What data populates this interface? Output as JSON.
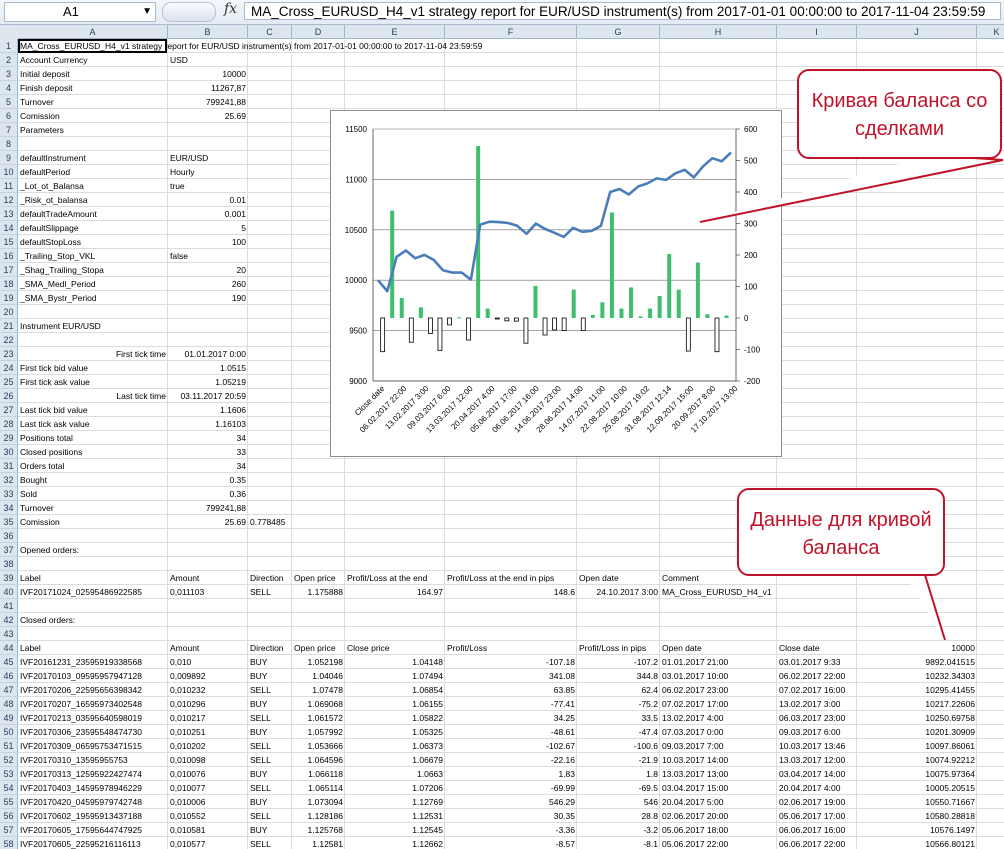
{
  "formula_bar": {
    "name_box": "A1",
    "fx": "fx",
    "content": "MA_Cross_EURUSD_H4_v1 strategy report for EUR/USD instrument(s) from 2017-01-01 00:00:00 to 2017-11-04 23:59:59"
  },
  "columns": [
    "A",
    "B",
    "C",
    "D",
    "E",
    "F",
    "G",
    "H",
    "I",
    "J",
    "K"
  ],
  "rows": [
    {
      "n": "1",
      "A": "MA_Cross_EURUSD_H4_v1 strategy report for EUR/USD instrument(s) from 2017-01-01 00:00:00 to 2017-11-04 23:59:59"
    },
    {
      "n": "2",
      "A": "Account Currency",
      "B": "USD"
    },
    {
      "n": "3",
      "A": "Initial deposit",
      "B": "10000"
    },
    {
      "n": "4",
      "A": "Finish deposit",
      "B": "11267,87"
    },
    {
      "n": "5",
      "A": "Turnover",
      "B": "799241,88"
    },
    {
      "n": "6",
      "A": "Comission",
      "B": "25.69"
    },
    {
      "n": "7",
      "A": "Parameters"
    },
    {
      "n": "8"
    },
    {
      "n": "9",
      "A": "defaultInstrument",
      "B": "EUR/USD"
    },
    {
      "n": "10",
      "A": "defaultPeriod",
      "B": "Hourly"
    },
    {
      "n": "11",
      "A": "_Lot_ot_Balansa",
      "B": "true"
    },
    {
      "n": "12",
      "A": "_Risk_ot_balansa",
      "B": "0.01"
    },
    {
      "n": "13",
      "A": "defaultTradeAmount",
      "B": "0.001"
    },
    {
      "n": "14",
      "A": "defaultSlippage",
      "B": "5"
    },
    {
      "n": "15",
      "A": "defaultStopLoss",
      "B": "100"
    },
    {
      "n": "16",
      "A": "_Trailing_Stop_VKL",
      "B": "false"
    },
    {
      "n": "17",
      "A": "_Shag_Trailing_Stopa",
      "B": "20"
    },
    {
      "n": "18",
      "A": "_SMA_Medl_Period",
      "B": "260"
    },
    {
      "n": "19",
      "A": "_SMA_Bystr_Period",
      "B": "190"
    },
    {
      "n": "20"
    },
    {
      "n": "21",
      "A": "Instrument EUR/USD"
    },
    {
      "n": "22"
    },
    {
      "n": "23",
      "A": "First tick time",
      "B": "01.01.2017 0:00"
    },
    {
      "n": "24",
      "A": "First tick bid value",
      "B": "1.0515"
    },
    {
      "n": "25",
      "A": "First tick ask value",
      "B": "1.05219"
    },
    {
      "n": "26",
      "A": "Last tick time",
      "B": "03.11.2017 20:59"
    },
    {
      "n": "27",
      "A": "Last tick bid value",
      "B": "1.1606"
    },
    {
      "n": "28",
      "A": "Last tick ask value",
      "B": "1.16103"
    },
    {
      "n": "29",
      "A": "Positions total",
      "B": "34"
    },
    {
      "n": "30",
      "A": "Closed positions",
      "B": "33"
    },
    {
      "n": "31",
      "A": "Orders total",
      "B": "34"
    },
    {
      "n": "32",
      "A": "Bought",
      "B": "0.35"
    },
    {
      "n": "33",
      "A": "Sold",
      "B": "0.36"
    },
    {
      "n": "34",
      "A": "Turnover",
      "B": "799241,88"
    },
    {
      "n": "35",
      "A": "Comission",
      "B": "25.69",
      "C": "0.778485"
    },
    {
      "n": "36"
    },
    {
      "n": "37",
      "A": "Opened orders:"
    },
    {
      "n": "38"
    },
    {
      "n": "39",
      "A": "Label",
      "B": "Amount",
      "C": "Direction",
      "D": "Open price",
      "E": "Profit/Loss at the end",
      "F": "Profit/Loss at the end in pips",
      "G": "Open date",
      "H": "Comment"
    },
    {
      "n": "40",
      "A": "IVF20171024_02595486922585",
      "B": "0,011103",
      "C": "SELL",
      "D": "1.175888",
      "E": "164.97",
      "F": "148.6",
      "G": "24.10.2017 3:00",
      "H": "MA_Cross_EURUSD_H4_v1"
    },
    {
      "n": "41"
    },
    {
      "n": "42",
      "A": "Closed orders:"
    },
    {
      "n": "43"
    },
    {
      "n": "44",
      "A": "Label",
      "B": "Amount",
      "C": "Direction",
      "D": "Open price",
      "E": "Close price",
      "F": "Profit/Loss",
      "G": "Profit/Loss in pips",
      "H": "Open date",
      "I": "Close date",
      "J": "10000"
    },
    {
      "n": "45",
      "A": "IVF20161231_23595919338568",
      "B": "0,010",
      "C": "BUY",
      "D": "1.052198",
      "E": "1.04148",
      "F": "-107.18",
      "G": "-107.2",
      "H": "01.01.2017 21:00",
      "I": "03.01.2017 9:33",
      "J": "9892.041515"
    },
    {
      "n": "46",
      "A": "IVF20170103_09595957947128",
      "B": "0,009892",
      "C": "BUY",
      "D": "1.04046",
      "E": "1.07494",
      "F": "341.08",
      "G": "344.8",
      "H": "03.01.2017 10:00",
      "I": "06.02.2017 22:00",
      "J": "10232.34303"
    },
    {
      "n": "47",
      "A": "IVF20170206_22595656398342",
      "B": "0,010232",
      "C": "SELL",
      "D": "1.07478",
      "E": "1.06854",
      "F": "63.85",
      "G": "62.4",
      "H": "06.02.2017 23:00",
      "I": "07.02.2017 16:00",
      "J": "10295.41455"
    },
    {
      "n": "48",
      "A": "IVF20170207_16595973402548",
      "B": "0,010296",
      "C": "BUY",
      "D": "1.069068",
      "E": "1.06155",
      "F": "-77.41",
      "G": "-75.2",
      "H": "07.02.2017 17:00",
      "I": "13.02.2017 3:00",
      "J": "10217.22606"
    },
    {
      "n": "49",
      "A": "IVF20170213_03595640598019",
      "B": "0,010217",
      "C": "SELL",
      "D": "1.061572",
      "E": "1.05822",
      "F": "34.25",
      "G": "33.5",
      "H": "13.02.2017 4:00",
      "I": "06.03.2017 23:00",
      "J": "10250.69758"
    },
    {
      "n": "50",
      "A": "IVF20170306_23595548474730",
      "B": "0,010251",
      "C": "BUY",
      "D": "1.057992",
      "E": "1.05325",
      "F": "-48.61",
      "G": "-47.4",
      "H": "07.03.2017 0:00",
      "I": "09.03.2017 6:00",
      "J": "10201.30909"
    },
    {
      "n": "51",
      "A": "IVF20170309_06595753471515",
      "B": "0,010202",
      "C": "SELL",
      "D": "1.053666",
      "E": "1.06373",
      "F": "-102.67",
      "G": "-100.6",
      "H": "09.03.2017 7:00",
      "I": "10.03.2017 13:46",
      "J": "10097.86061"
    },
    {
      "n": "52",
      "A": "IVF20170310_13595955753",
      "B": "0,010098",
      "C": "SELL",
      "D": "1.064596",
      "E": "1.06679",
      "F": "-22.16",
      "G": "-21.9",
      "H": "10.03.2017 14:00",
      "I": "13.03.2017 12:00",
      "J": "10074.92212"
    },
    {
      "n": "53",
      "A": "IVF20170313_12595922427474",
      "B": "0,010076",
      "C": "BUY",
      "D": "1.066118",
      "E": "1.0663",
      "F": "1.83",
      "G": "1.8",
      "H": "13.03.2017 13:00",
      "I": "03.04.2017 14:00",
      "J": "10075.97364"
    },
    {
      "n": "54",
      "A": "IVF20170403_14595978946229",
      "B": "0,010077",
      "C": "SELL",
      "D": "1.065114",
      "E": "1.07206",
      "F": "-69.99",
      "G": "-69.5",
      "H": "03.04.2017 15:00",
      "I": "20.04.2017 4:00",
      "J": "10005.20515"
    },
    {
      "n": "55",
      "A": "IVF20170420_04595979742748",
      "B": "0,010006",
      "C": "BUY",
      "D": "1.073094",
      "E": "1.12769",
      "F": "546.29",
      "G": "546",
      "H": "20.04.2017 5:00",
      "I": "02.06.2017 19:00",
      "J": "10550.71667"
    },
    {
      "n": "56",
      "A": "IVF20170602_19595913437188",
      "B": "0,010552",
      "C": "SELL",
      "D": "1.128186",
      "E": "1.12531",
      "F": "30.35",
      "G": "28.8",
      "H": "02.06.2017 20:00",
      "I": "05.06.2017 17:00",
      "J": "10580.28818"
    },
    {
      "n": "57",
      "A": "IVF20170605_17595644747925",
      "B": "0,010581",
      "C": "BUY",
      "D": "1.125768",
      "E": "1.12545",
      "F": "-3.36",
      "G": "-3.2",
      "H": "05.06.2017 18:00",
      "I": "06.06.2017 16:00",
      "J": "10576.1497"
    },
    {
      "n": "58",
      "A": "IVF20170605_22595216116113",
      "B": "0,010577",
      "C": "SELL",
      "D": "1.12581",
      "E": "1.12662",
      "F": "-8.57",
      "G": "-8.1",
      "H": "05.06.2017 22:00",
      "I": "06.06.2017 22:00",
      "J": "10566.80121"
    }
  ],
  "chart_data": {
    "type": "combo",
    "title": "",
    "y_left": {
      "min": 9000,
      "max": 11500,
      "step": 500,
      "ticks": [
        "9000",
        "9500",
        "10000",
        "10500",
        "11000",
        "11500"
      ]
    },
    "y_right": {
      "min": -200,
      "max": 600,
      "step": 100,
      "ticks": [
        "-200",
        "-100",
        "0",
        "100",
        "200",
        "300",
        "400",
        "500",
        "600"
      ]
    },
    "x_labels": [
      "Close date",
      "06.02.2017 22:00",
      "13.02.2017 3:00",
      "09.03.2017 6:00",
      "13.03.2017 12:00",
      "20.04.2017 4:00",
      "05.06.2017 17:00",
      "06.06.2017 16:00",
      "14.06.2017 23:00",
      "28.06.2017 14:00",
      "14.07.2017 11:00",
      "22.08.2017 10:00",
      "25.08.2017 19:02",
      "31.08.2017 12:14",
      "12.09.2017 15:00",
      "20.09.2017 8:00",
      "17.10.2017 13:00"
    ],
    "balance_series": [
      10000,
      9892,
      10232,
      10295,
      10217,
      10251,
      10201,
      10098,
      10075,
      10076,
      10005,
      10551,
      10580,
      10576,
      10567,
      10540,
      10460,
      10562,
      10508,
      10470,
      10430,
      10520,
      10480,
      10490,
      10540,
      10875,
      10905,
      10850,
      10930,
      10960,
      11010,
      10995,
      11060,
      11095,
      11020,
      11130,
      11210,
      11180,
      11267
    ],
    "trade_series": [
      -107,
      341,
      64,
      -77,
      34,
      -49,
      -103,
      -22,
      2,
      -70,
      546,
      30,
      -3,
      -9,
      -10,
      -80,
      102,
      -54,
      -38,
      -40,
      90,
      -40,
      10,
      50,
      335,
      30,
      97,
      5,
      30,
      70,
      203,
      90,
      -105,
      176,
      12,
      -107,
      8
    ],
    "colors": {
      "line": "#4a7ebb",
      "positive": "#3fbf6e",
      "negative_fill": "#ffffff",
      "negative_stroke": "#000000",
      "grid": "#6e6e6e"
    }
  },
  "callouts": {
    "balance_curve": "Кривая баланса со сделками",
    "balance_data": "Данные для кривой баланса"
  }
}
